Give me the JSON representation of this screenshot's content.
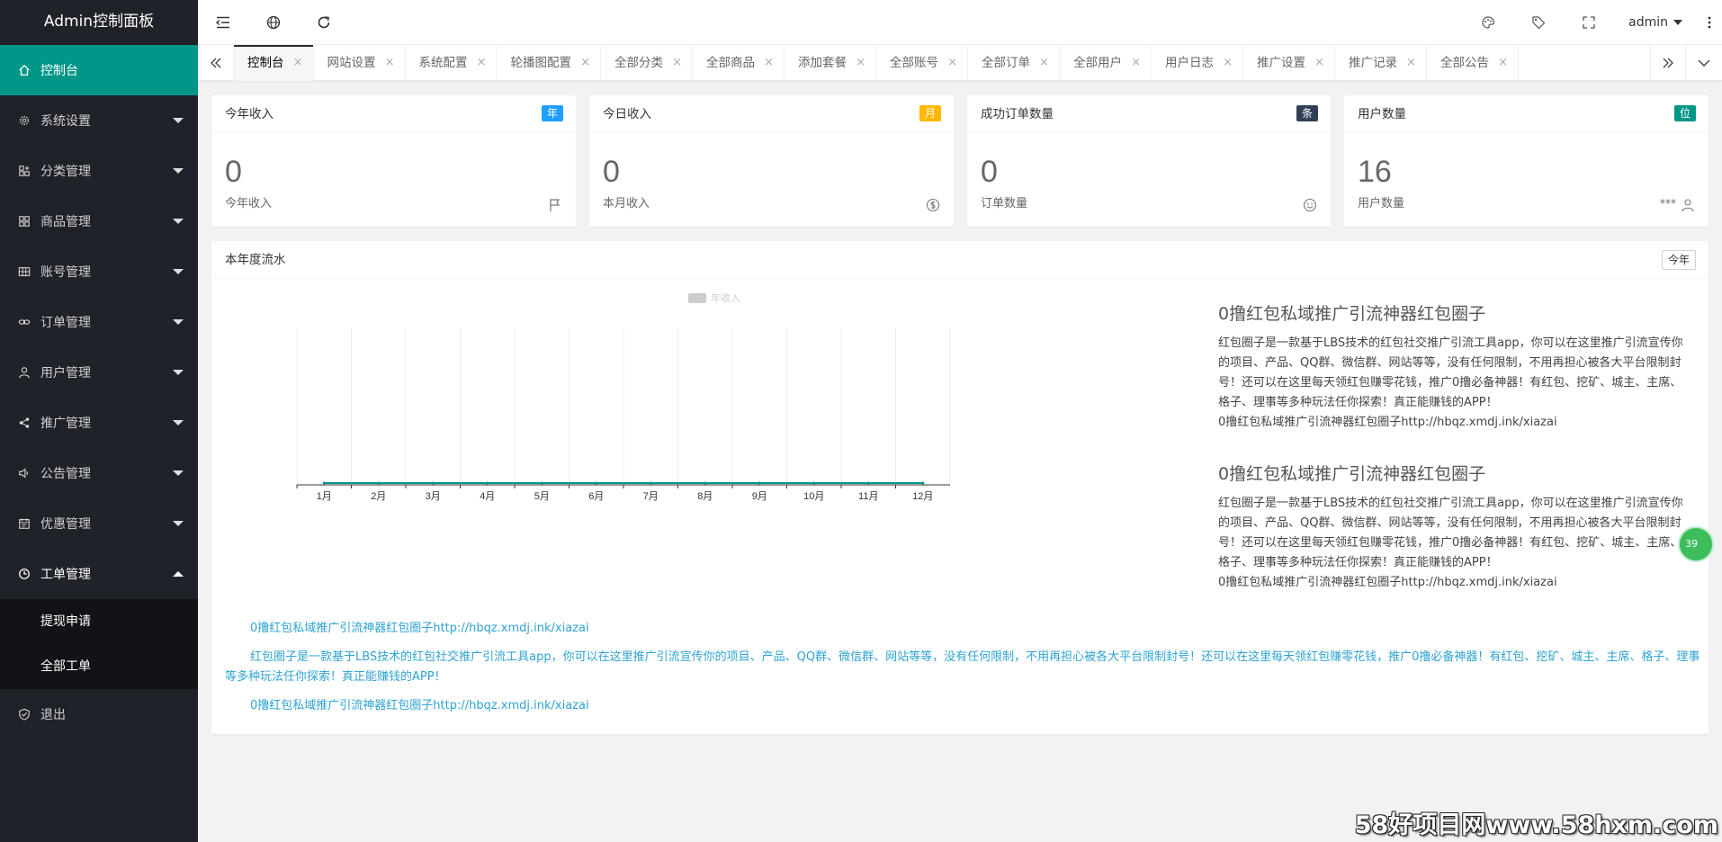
{
  "app": {
    "title": "Admin控制面板"
  },
  "sidebar": {
    "items": [
      {
        "label": "控制台",
        "icon": "home-icon"
      },
      {
        "label": "系统设置",
        "icon": "gear-icon"
      },
      {
        "label": "分类管理",
        "icon": "apps-icon"
      },
      {
        "label": "商品管理",
        "icon": "apps-icon"
      },
      {
        "label": "账号管理",
        "icon": "grid-icon"
      },
      {
        "label": "订单管理",
        "icon": "link-icon"
      },
      {
        "label": "用户管理",
        "icon": "user-icon"
      },
      {
        "label": "推广管理",
        "icon": "share-icon"
      },
      {
        "label": "公告管理",
        "icon": "speaker-icon"
      },
      {
        "label": "优惠管理",
        "icon": "calendar-icon"
      },
      {
        "label": "工单管理",
        "icon": "clock-icon"
      }
    ],
    "sub_items": [
      "提现申请",
      "全部工单"
    ],
    "logout": "退出"
  },
  "header": {
    "user": "admin"
  },
  "tabs": [
    "控制台",
    "网站设置",
    "系统配置",
    "轮播图配置",
    "全部分类",
    "全部商品",
    "添加套餐",
    "全部账号",
    "全部订单",
    "全部用户",
    "用户日志",
    "推广设置",
    "推广记录",
    "全部公告"
  ],
  "cards": [
    {
      "title": "今年收入",
      "badge": "年",
      "badge_color": "#1e9fff",
      "value": "0",
      "sub": "今年收入",
      "icon": "flag-icon"
    },
    {
      "title": "今日收入",
      "badge": "月",
      "badge_color": "#ffb800",
      "value": "0",
      "sub": "本月收入",
      "icon": "dollar-icon"
    },
    {
      "title": "成功订单数量",
      "badge": "条",
      "badge_color": "#2f4056",
      "value": "0",
      "sub": "订单数量",
      "icon": "smile-icon"
    },
    {
      "title": "用户数量",
      "badge": "位",
      "badge_color": "#009688",
      "value": "16",
      "sub": "用户数量",
      "icon": "user-icon",
      "mask": "***"
    }
  ],
  "panel": {
    "title": "本年度流水",
    "button": "今年"
  },
  "chart_data": {
    "type": "line",
    "categories": [
      "1月",
      "2月",
      "3月",
      "4月",
      "5月",
      "6月",
      "7月",
      "8月",
      "9月",
      "10月",
      "11月",
      "12月"
    ],
    "series": [
      {
        "name": "年收入",
        "values": [
          0,
          0,
          0,
          0,
          0,
          0,
          0,
          0,
          0,
          0,
          0,
          0
        ],
        "color": "#009688"
      }
    ],
    "legend": "top-center",
    "grid": true
  },
  "articles": [
    {
      "title": "0撸红包私域推广引流神器红包圈子",
      "body": "红包圈子是一款基于LBS技术的红包社交推广引流工具app，你可以在这里推广引流宣传你的项目、产品、QQ群、微信群、网站等等，没有任何限制，不用再担心被各大平台限制封号！还可以在这里每天领红包赚零花钱，推广0撸必备神器！有红包、挖矿、城主、主席、格子、理事等多种玩法任你探索！真正能赚钱的APP！",
      "link": "0撸红包私域推广引流神器红包圈子http://hbqz.xmdj.ink/xiazai"
    },
    {
      "title": "0撸红包私域推广引流神器红包圈子",
      "body": "红包圈子是一款基于LBS技术的红包社交推广引流工具app，你可以在这里推广引流宣传你的项目、产品、QQ群、微信群、网站等等，没有任何限制，不用再担心被各大平台限制封号！还可以在这里每天领红包赚零花钱，推广0撸必备神器！有红包、挖矿、城主、主席、格子、理事等多种玩法任你探索！真正能赚钱的APP！",
      "link": "0撸红包私域推广引流神器红包圈子http://hbqz.xmdj.ink/xiazai"
    }
  ],
  "bottom": {
    "line1": "0撸红包私域推广引流神器红包圈子http://hbqz.xmdj.ink/xiazai",
    "line2": "红包圈子是一款基于LBS技术的红包社交推广引流工具app，你可以在这里推广引流宣传你的项目、产品、QQ群、微信群、网站等等，没有任何限制，不用再担心被各大平台限制封号！还可以在这里每天领红包赚零花钱，推广0撸必备神器！有红包、挖矿、城主、主席、格子、理事等多种玩法任你探索！真正能赚钱的APP！",
    "line3": "0撸红包私域推广引流神器红包圈子http://hbqz.xmdj.ink/xiazai"
  },
  "floating_badge": "39",
  "watermark": "58好项目网www.58hxm.com"
}
